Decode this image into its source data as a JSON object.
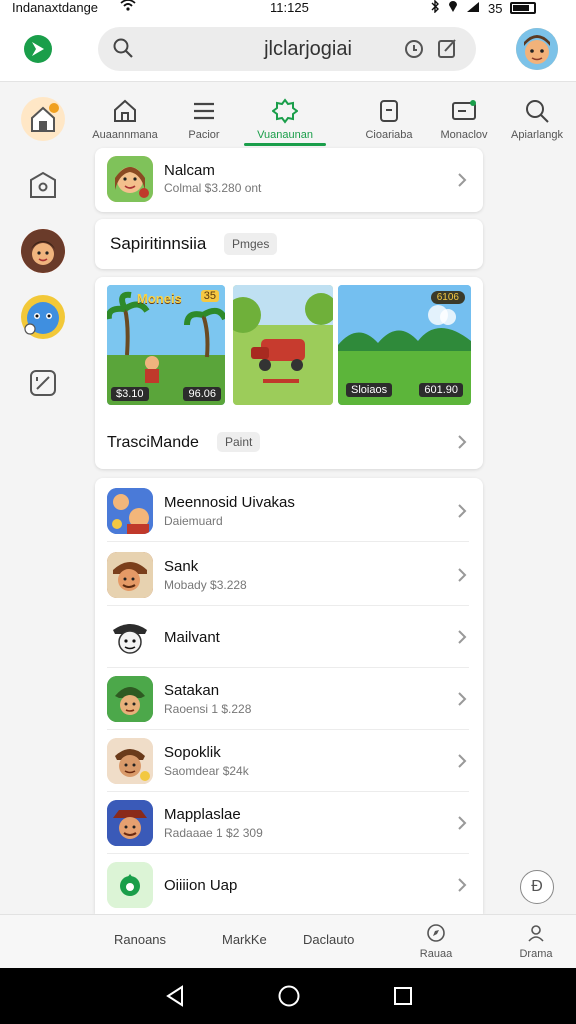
{
  "status_bar": {
    "carrier": "Indanaxtdange",
    "time": "11:125",
    "battery_text": "35"
  },
  "header": {
    "search_value": "jlclarjogiai"
  },
  "tabs": [
    {
      "label": "Auaannmana",
      "icon": "home-icon"
    },
    {
      "label": "Pacior",
      "icon": "menu-icon"
    },
    {
      "label": "Vuanaunan",
      "icon": "star-badge-icon",
      "active": true
    },
    {
      "label": "Cioariaba",
      "icon": "document-icon"
    },
    {
      "label": "Monaclov",
      "icon": "inbox-icon"
    },
    {
      "label": "Apiarlangk",
      "icon": "search-icon"
    }
  ],
  "featured_app": {
    "name": "Nalcam",
    "sub": "Colmal $3.280 ont"
  },
  "section": {
    "title": "Sapiritinnsiia",
    "pill": "Pmges"
  },
  "gallery": {
    "shot1_title": "Moneis",
    "shot1_badge": "35",
    "shot1_price_left": "$3.10",
    "shot1_price_right": "96.06",
    "shot3_badge": "6106",
    "shot3_price_left": "Sloiaos",
    "shot3_price_right": "601.90",
    "footer_title": "TrasciMande",
    "footer_pill": "Paint"
  },
  "list": [
    {
      "name": "Meennosid Uivakas",
      "sub": "Daiemuard"
    },
    {
      "name": "Sank",
      "sub": "Mobady $3.228"
    },
    {
      "name": "Mailvant",
      "sub": ""
    },
    {
      "name": "Satakan",
      "sub": "Raoensi 1 $.228"
    },
    {
      "name": "Sopoklik",
      "sub": "Saomdear $24k"
    },
    {
      "name": "Mapplaslae",
      "sub": "Radaaae 1 $2 309"
    },
    {
      "name": "Oiiiion Uap",
      "sub": ""
    }
  ],
  "bottom_nav": {
    "item1": "Ranoans",
    "item2": "MarkKe",
    "item3": "Daclauto",
    "item4": "Rauaa",
    "item5": "Drama"
  },
  "fab_glyph": "Ð",
  "colors": {
    "accent": "#1a9e4a",
    "background": "#f4f4f4"
  }
}
